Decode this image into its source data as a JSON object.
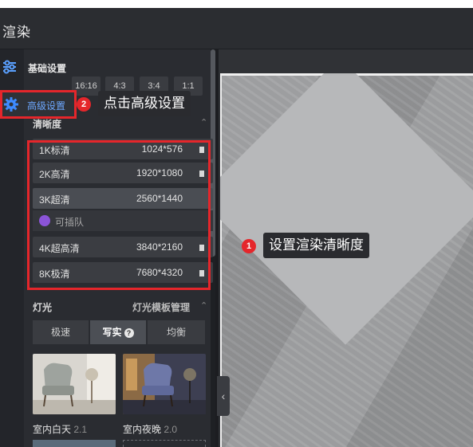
{
  "app": {
    "title": "渲染"
  },
  "nav": {
    "basic_label": "基础设置",
    "advanced_label": "高级设置"
  },
  "ratios": [
    "16:16",
    "4:3",
    "3:4",
    "1:1"
  ],
  "resolution": {
    "header": "清晰度",
    "options": [
      {
        "name": "1K标清",
        "value": "1024*576"
      },
      {
        "name": "2K高清",
        "value": "1920*1080"
      },
      {
        "name": "3K超清",
        "value": "2560*1440",
        "selected": true
      },
      {
        "name": "4K超高清",
        "value": "3840*2160"
      },
      {
        "name": "8K极清",
        "value": "7680*4320"
      }
    ],
    "queue_label": "可插队"
  },
  "lighting": {
    "header": "灯光",
    "template_manage": "灯光模板管理",
    "modes": [
      "极速",
      "写实",
      "均衡"
    ],
    "active_mode": "写实",
    "help_glyph": "?",
    "presets": [
      {
        "name": "室内白天",
        "version": "2.1"
      },
      {
        "name": "室内夜晚",
        "version": "2.0"
      }
    ]
  },
  "annotations": {
    "step1_number": "1",
    "step1_text": "设置渲染清晰度",
    "step2_number": "2",
    "step2_text": "点击高级设置"
  },
  "colors": {
    "highlight_red": "#e5262b",
    "link_blue": "#6da8ff",
    "panel_bg": "#2a2c31",
    "gem_purple": "#8b54d8"
  },
  "icons": {
    "basic": "sliders-icon",
    "advanced": "gear-icon",
    "collapse": "chevron-up-icon",
    "toggle": "chevron-left-icon"
  }
}
